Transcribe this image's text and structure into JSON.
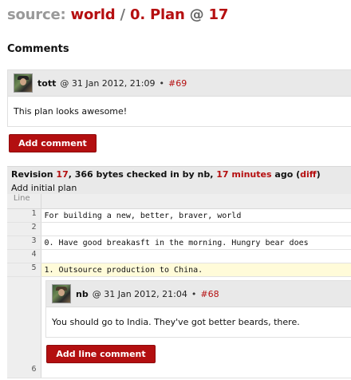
{
  "title": {
    "source_label": "source:",
    "project": "world",
    "separator": "/",
    "file": "0. Plan",
    "at": "@",
    "revision": "17"
  },
  "comments_heading": "Comments",
  "comment1": {
    "user": "tott",
    "date": "@ 31 Jan 2012, 21:09",
    "bullet": "•",
    "id": "#69",
    "body": "This plan looks awesome!"
  },
  "add_comment_label": "Add comment",
  "revision": {
    "prefix": "Revision",
    "number": "17",
    "bytes": ", 366 bytes checked in by nb,",
    "ago": "17 minutes",
    "ago_suffix": "ago (",
    "diff": "diff",
    "close": ")",
    "message": "Add initial plan"
  },
  "code": {
    "header": "Line",
    "lines": [
      {
        "n": "1",
        "text": "For building a new, better, braver, world"
      },
      {
        "n": "2",
        "text": ""
      },
      {
        "n": "3",
        "text": "0. Have good breakasft in the morning. Hungry bear does"
      },
      {
        "n": "4",
        "text": ""
      },
      {
        "n": "5",
        "text": "1. Outsource production to China."
      },
      {
        "n": "6",
        "text": ""
      }
    ]
  },
  "comment2": {
    "user": "nb",
    "date": "@ 31 Jan 2012, 21:04",
    "bullet": "•",
    "id": "#68",
    "body": "You should go to India. They've got better beards, there."
  },
  "add_line_comment_label": "Add line comment",
  "colors": {
    "accent": "#b50f10",
    "button": "#b30f10",
    "header_bg": "#e9e9e9",
    "highlight": "#fffbd9"
  }
}
